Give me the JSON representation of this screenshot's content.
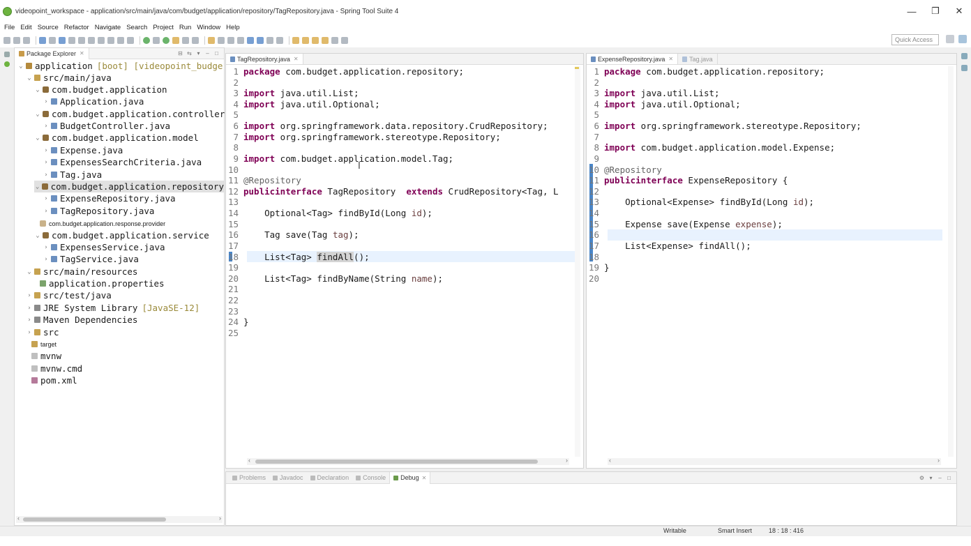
{
  "window": {
    "title": "videopoint_workspace - application/src/main/java/com/budget/application/repository/TagRepository.java - Spring Tool Suite 4",
    "minimize": "—",
    "restore": "❐",
    "close": "✕"
  },
  "menu": [
    "File",
    "Edit",
    "Source",
    "Refactor",
    "Navigate",
    "Search",
    "Project",
    "Run",
    "Window",
    "Help"
  ],
  "toolbar": {
    "quick_access_placeholder": "Quick Access"
  },
  "package_explorer": {
    "tab_label": "Package Explorer",
    "project_name": "application",
    "project_decoration": "[boot] [videopoint_budge",
    "items": [
      {
        "label": "src/main/java"
      },
      {
        "label": "com.budget.application"
      },
      {
        "label": "Application.java"
      },
      {
        "label": "com.budget.application.controller"
      },
      {
        "label": "BudgetController.java"
      },
      {
        "label": "com.budget.application.model"
      },
      {
        "label": "Expense.java"
      },
      {
        "label": "ExpensesSearchCriteria.java"
      },
      {
        "label": "Tag.java"
      },
      {
        "label": "com.budget.application.repository"
      },
      {
        "label": "ExpenseRepository.java"
      },
      {
        "label": "TagRepository.java"
      },
      {
        "label": "com.budget.application.response.provider"
      },
      {
        "label": "com.budget.application.service"
      },
      {
        "label": "ExpensesService.java"
      },
      {
        "label": "TagService.java"
      },
      {
        "label": "src/main/resources"
      },
      {
        "label": "application.properties"
      },
      {
        "label": "src/test/java"
      },
      {
        "label": "JRE System Library"
      },
      {
        "label": "Maven Dependencies"
      },
      {
        "label": "src"
      },
      {
        "label": "target"
      },
      {
        "label": "mvnw"
      },
      {
        "label": "mvnw.cmd"
      },
      {
        "label": "pom.xml"
      }
    ],
    "jre_decoration": "[JavaSE-12]"
  },
  "editor_left": {
    "tab_label": "TagRepository.java",
    "lines": [
      {
        "n": "1",
        "kw": "package",
        "text": " com.budget.application.repository;"
      },
      {
        "n": "2",
        "text": ""
      },
      {
        "n": "3",
        "kw": "import",
        "text": " java.util.List;"
      },
      {
        "n": "4",
        "kw": "import",
        "text": " java.util.Optional;"
      },
      {
        "n": "5",
        "text": ""
      },
      {
        "n": "6",
        "kw": "import",
        "text": " org.springframework.data.repository.CrudRepository;"
      },
      {
        "n": "7",
        "kw": "import",
        "text": " org.springframework.stereotype.Repository;"
      },
      {
        "n": "8",
        "text": ""
      },
      {
        "n": "9",
        "kw": "import",
        "text": " com.budget.application.model.Tag;"
      },
      {
        "n": "10",
        "text": ""
      },
      {
        "n": "11",
        "anno": "@Repository"
      },
      {
        "n": "12",
        "kw": "public",
        "kw2": "interface",
        "text": " TagRepository  ",
        "kw3": "extends",
        "text2": " CrudRepository<Tag, L"
      },
      {
        "n": "13",
        "text": ""
      },
      {
        "n": "14",
        "text": "    Optional<Tag> findById(Long ",
        "param": "id",
        "text2": ");"
      },
      {
        "n": "15",
        "text": ""
      },
      {
        "n": "16",
        "text": "    Tag save(Tag ",
        "param": "tag",
        "text2": ");"
      },
      {
        "n": "17",
        "text": ""
      },
      {
        "n": "18",
        "text": "    List<Tag> ",
        "hl": "findAll",
        "text2": "();"
      },
      {
        "n": "19",
        "text": ""
      },
      {
        "n": "20",
        "text": "    List<Tag> findByName(String ",
        "param": "name",
        "text2": ");"
      },
      {
        "n": "21",
        "text": ""
      },
      {
        "n": "22",
        "text": ""
      },
      {
        "n": "23",
        "text": ""
      },
      {
        "n": "24",
        "text": "}"
      },
      {
        "n": "25",
        "text": ""
      }
    ]
  },
  "editor_right": {
    "tab_label": "ExpenseRepository.java",
    "tab2_label": "Tag.java",
    "lines": [
      {
        "n": "1",
        "kw": "package",
        "text": " com.budget.application.repository;"
      },
      {
        "n": "2",
        "text": ""
      },
      {
        "n": "3",
        "kw": "import",
        "text": " java.util.List;"
      },
      {
        "n": "4",
        "kw": "import",
        "text": " java.util.Optional;"
      },
      {
        "n": "5",
        "text": ""
      },
      {
        "n": "6",
        "kw": "import",
        "text": " org.springframework.stereotype.Repository;"
      },
      {
        "n": "7",
        "text": ""
      },
      {
        "n": "8",
        "kw": "import",
        "text": " com.budget.application.model.Expense;"
      },
      {
        "n": "9",
        "text": ""
      },
      {
        "n": "10",
        "anno": "@Repository"
      },
      {
        "n": "11",
        "kw": "public",
        "kw2": "interface",
        "text": " ExpenseRepository {"
      },
      {
        "n": "12",
        "text": ""
      },
      {
        "n": "13",
        "text": "    Optional<Expense> findById(Long ",
        "param": "id",
        "text2": ");"
      },
      {
        "n": "14",
        "text": ""
      },
      {
        "n": "15",
        "text": "    Expense save(Expense ",
        "param": "expense",
        "text2": ");"
      },
      {
        "n": "16",
        "text": ""
      },
      {
        "n": "17",
        "text": "    List<Expense> findAll();"
      },
      {
        "n": "18",
        "text": ""
      },
      {
        "n": "19",
        "text": "}"
      },
      {
        "n": "20",
        "text": ""
      }
    ]
  },
  "bottom_panel": {
    "tabs": [
      {
        "label": "Problems"
      },
      {
        "label": "Javadoc"
      },
      {
        "label": "Declaration"
      },
      {
        "label": "Console"
      },
      {
        "label": "Debug"
      }
    ]
  },
  "status": {
    "writable": "Writable",
    "insert_mode": "Smart Insert",
    "position": "18 : 18 : 416"
  }
}
